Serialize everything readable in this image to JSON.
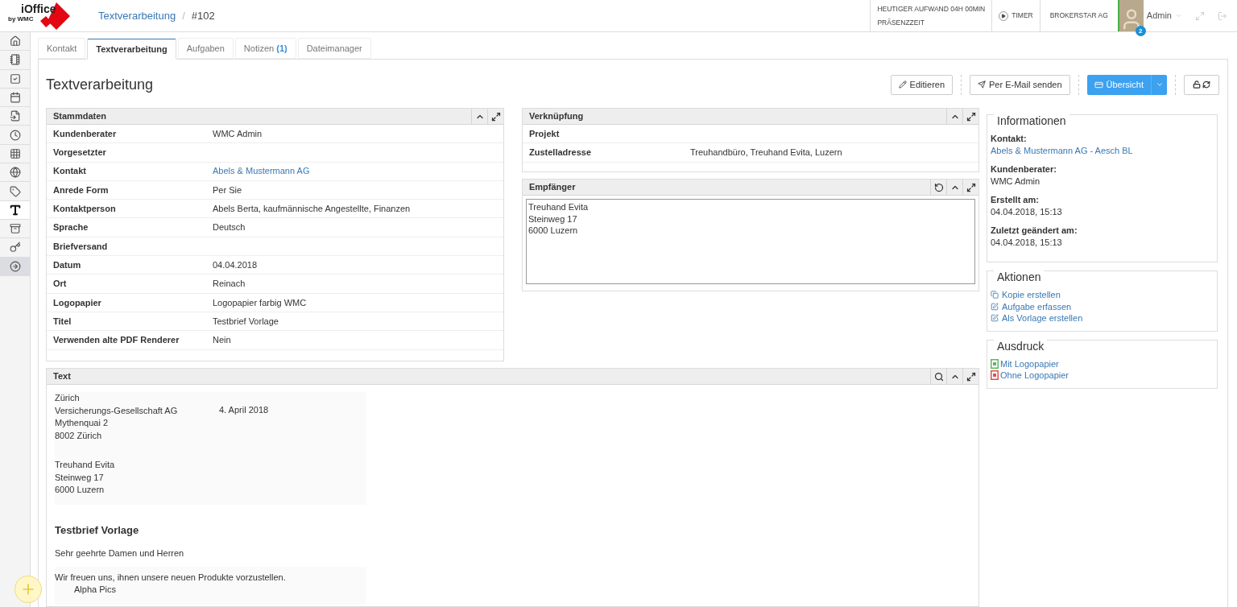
{
  "header": {
    "logo_text": "iOffice",
    "logo_sub": "by WMC",
    "breadcrumb": [
      {
        "label": "Textverarbeitung",
        "kind": "link"
      },
      {
        "label": "#102",
        "kind": "current"
      }
    ],
    "separator": "/",
    "effort": "HEUTIGER AUFWAND 04H 00MIN",
    "presence": "PRÄSENZZEIT",
    "timer": "TIMER",
    "company": "BROKERSTAR AG",
    "user": "Admin",
    "badge": "2"
  },
  "sidebar": {
    "items": [
      {
        "kind": "home",
        "selected": false
      },
      {
        "kind": "notebook",
        "selected": false
      },
      {
        "kind": "check",
        "selected": false
      },
      {
        "kind": "calendar",
        "selected": false
      },
      {
        "kind": "document",
        "selected": false
      },
      {
        "kind": "clock",
        "selected": false
      },
      {
        "kind": "table",
        "selected": false
      },
      {
        "kind": "globe",
        "selected": false
      },
      {
        "kind": "tag",
        "selected": false
      },
      {
        "kind": "text",
        "selected": true
      },
      {
        "kind": "archive",
        "selected": false
      },
      {
        "kind": "key",
        "selected": false
      },
      {
        "kind": "arrow",
        "selected": false,
        "highlighted": true
      }
    ]
  },
  "tabs": [
    {
      "label": "Kontakt",
      "selected": false
    },
    {
      "label": "Textverarbeitung",
      "selected": true
    },
    {
      "label": "Aufgaben",
      "selected": false
    },
    {
      "label": "Notizen",
      "count": "(1)",
      "selected": false
    },
    {
      "label": "Dateimanager",
      "selected": false
    }
  ],
  "page_title": "Textverarbeitung",
  "toolbar": {
    "edit": "Editieren",
    "email": "Per E-Mail senden",
    "overview": "Übersicht"
  },
  "stammdaten": {
    "title": "Stammdaten",
    "rows": [
      {
        "label": "Kundenberater",
        "value": "WMC Admin"
      },
      {
        "label": "Vorgesetzter"
      },
      {
        "label": "Kontakt",
        "value": "Abels & Mustermann AG",
        "link": true
      },
      {
        "label": "Anrede Form",
        "value": "Per Sie"
      },
      {
        "label": "Kontaktperson",
        "value": "Abels Berta, kaufmännische Angestellte, Finanzen"
      },
      {
        "label": "Sprache",
        "value": "Deutsch"
      },
      {
        "label": "Briefversand"
      },
      {
        "label": "Datum",
        "value": "04.04.2018"
      },
      {
        "label": "Ort",
        "value": "Reinach"
      },
      {
        "label": "Logopapier",
        "value": "Logopapier farbig WMC"
      },
      {
        "label": "Titel",
        "value": "Testbrief Vorlage"
      },
      {
        "label": "Verwenden alte PDF Renderer",
        "value": "Nein"
      }
    ]
  },
  "verknuepfung": {
    "title": "Verknüpfung",
    "rows": [
      {
        "label": "Projekt"
      },
      {
        "label": "Zustelladresse",
        "value": "Treuhandbüro, Treuhand Evita, Luzern"
      }
    ]
  },
  "empfaenger": {
    "title": "Empfänger",
    "lines": [
      "Treuhand Evita",
      "Steinweg 17",
      "6000 Luzern"
    ]
  },
  "informationen": {
    "title": "Informationen",
    "fields": [
      {
        "label": "Kontakt:",
        "value": "Abels & Mustermann AG - Aesch BL",
        "link": true
      },
      {
        "label": "Kundenberater:",
        "value": "WMC Admin"
      },
      {
        "label": "Erstellt am:",
        "value": "04.04.2018, 15:13"
      },
      {
        "label": "Zuletzt geändert am:",
        "value": "04.04.2018, 15:13"
      }
    ]
  },
  "aktionen": {
    "title": "Aktionen",
    "items": [
      {
        "kind": "copy",
        "label": "Kopie erstellen"
      },
      {
        "kind": "edit",
        "label": "Aufgabe erfassen"
      },
      {
        "kind": "edit",
        "label": "Als Vorlage erstellen"
      }
    ]
  },
  "ausdruck": {
    "title": "Ausdruck",
    "items": [
      {
        "color": "#5cb85c",
        "label": "Mit Logopapier"
      },
      {
        "color": "#d9534f",
        "label": "Ohne Logopapier"
      }
    ]
  },
  "text_panel": {
    "title": "Text",
    "sender": [
      "Zürich",
      "Versicherungs-Gesellschaft AG",
      "Mythenquai 2",
      "8002 Zürich"
    ],
    "date": "4. April 2018",
    "recipient": [
      "Treuhand Evita",
      "Steinweg 17",
      "6000 Luzern"
    ],
    "heading": "Testbrief Vorlage",
    "salutation": "Sehr geehrte Damen und Herren",
    "body": "Wir freuen uns, ihnen unsere neuen Produkte vorzustellen.",
    "item": "Alpha Pics"
  }
}
